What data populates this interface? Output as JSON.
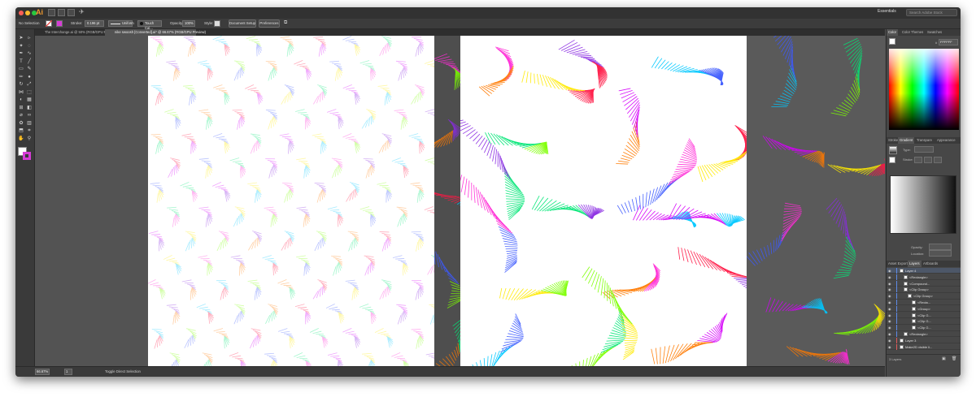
{
  "app": {
    "logo": "Ai",
    "workspace": "Essentials",
    "search_placeholder": "Search Adobe Stock"
  },
  "colors": {
    "window_bg": "#535353",
    "bar_dark": "#323232",
    "ai_orange": "#f29a2e",
    "layer_color": "#5e8ae6"
  },
  "control_bar": {
    "selection": "No Selection",
    "stroke_label": "Stroke:",
    "stroke_value": "0.196 pt",
    "uniform_label": "Uniform",
    "brush_label": "Touch Cal...",
    "opacity_label": "Opacity:",
    "opacity_value": "100%",
    "style_label": "Style:",
    "document_setup": "Document Setup",
    "preferences": "Preferences"
  },
  "tabs": [
    {
      "label": "The Interchange.ai @ 50% (RGB/GPU Preview)",
      "active": false
    },
    {
      "label": "nike swoosh [Converted].ai* @ 66.67% (RGB/GPU Preview)",
      "active": true
    }
  ],
  "status": {
    "zoom": "66.67%",
    "artboard": "1",
    "mode": "Toggle Direct Selection"
  },
  "panels": {
    "color_tabs": [
      "Color",
      "Color Themes",
      "Swatches"
    ],
    "color_hex": "FFFFFF",
    "gradient_tabs": [
      "Stroke",
      "Gradient",
      "Transpare",
      "Appearance"
    ],
    "gradient": {
      "type_label": "Type:",
      "stroke_label": "Stroke:",
      "opacity_label": "Opacity:",
      "location_label": "Location:"
    },
    "layers_tabs": [
      "Asset Export",
      "Layers",
      "Artboards"
    ],
    "layers": [
      {
        "name": "Layer 4",
        "indent": 0,
        "expanded": true
      },
      {
        "name": "<Rectangle>",
        "indent": 1
      },
      {
        "name": "<Compound...",
        "indent": 1
      },
      {
        "name": "<Clip Group>",
        "indent": 1
      },
      {
        "name": "<Clip Group>",
        "indent": 2
      },
      {
        "name": "<Recta...",
        "indent": 3
      },
      {
        "name": "<Group>",
        "indent": 3
      },
      {
        "name": "<Clip G...",
        "indent": 3
      },
      {
        "name": "<Clip G...",
        "indent": 3
      },
      {
        "name": "<Clip G...",
        "indent": 3
      },
      {
        "name": "<Rectangle>",
        "indent": 1
      },
      {
        "name": "Layer 3",
        "indent": 0
      },
      {
        "name": "Make2D visible li...",
        "indent": 0
      }
    ],
    "layer_count": "3 Layers"
  }
}
